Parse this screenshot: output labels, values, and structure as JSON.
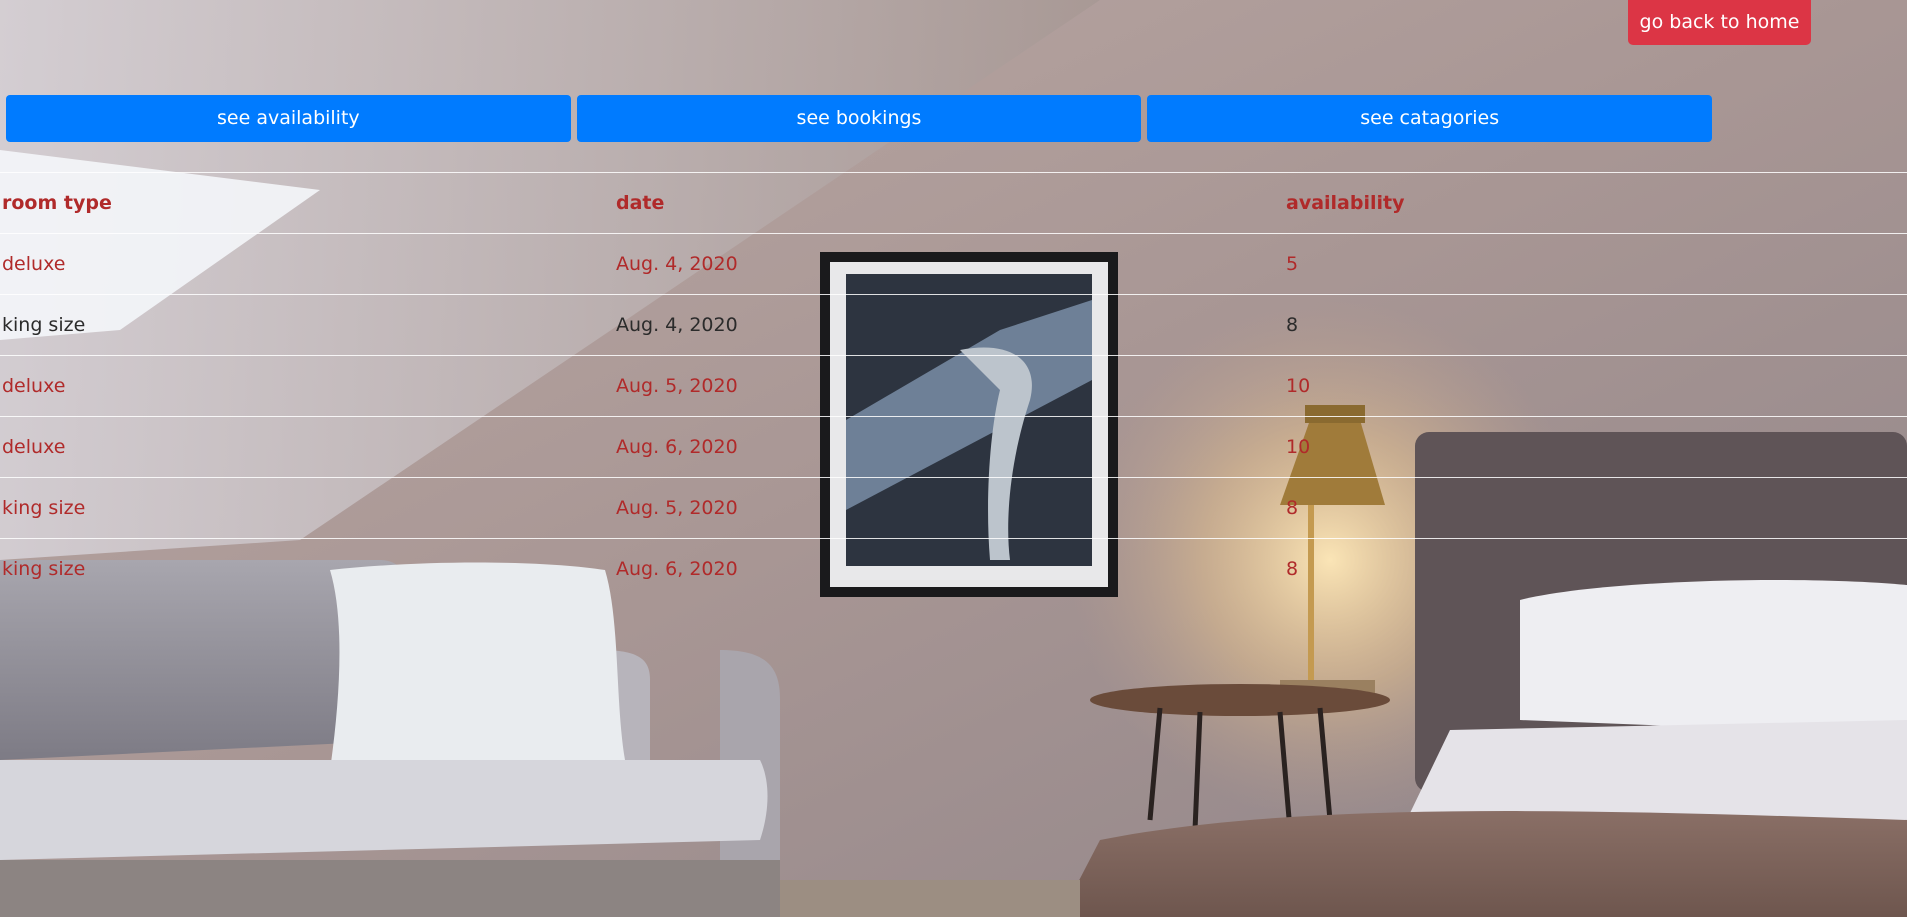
{
  "header": {
    "home_label": "go back to home"
  },
  "nav": {
    "buttons": [
      {
        "label": "see availability"
      },
      {
        "label": "see bookings"
      },
      {
        "label": "see catagories"
      }
    ]
  },
  "table": {
    "columns": [
      "room type",
      "date",
      "availability"
    ],
    "rows": [
      {
        "room_type": "deluxe",
        "date": "Aug. 4, 2020",
        "availability": "5"
      },
      {
        "room_type": "king size",
        "date": "Aug. 4, 2020",
        "availability": "8"
      },
      {
        "room_type": "deluxe",
        "date": "Aug. 5, 2020",
        "availability": "10"
      },
      {
        "room_type": "deluxe",
        "date": "Aug. 6, 2020",
        "availability": "10"
      },
      {
        "room_type": "king size",
        "date": "Aug. 5, 2020",
        "availability": "8"
      },
      {
        "room_type": "king size",
        "date": "Aug. 6, 2020",
        "availability": "8"
      }
    ]
  },
  "colors": {
    "home_button": "#dc3545",
    "nav_button": "#007bff",
    "table_text": "#b02a2a",
    "table_text_alt": "#2b2b2b"
  }
}
